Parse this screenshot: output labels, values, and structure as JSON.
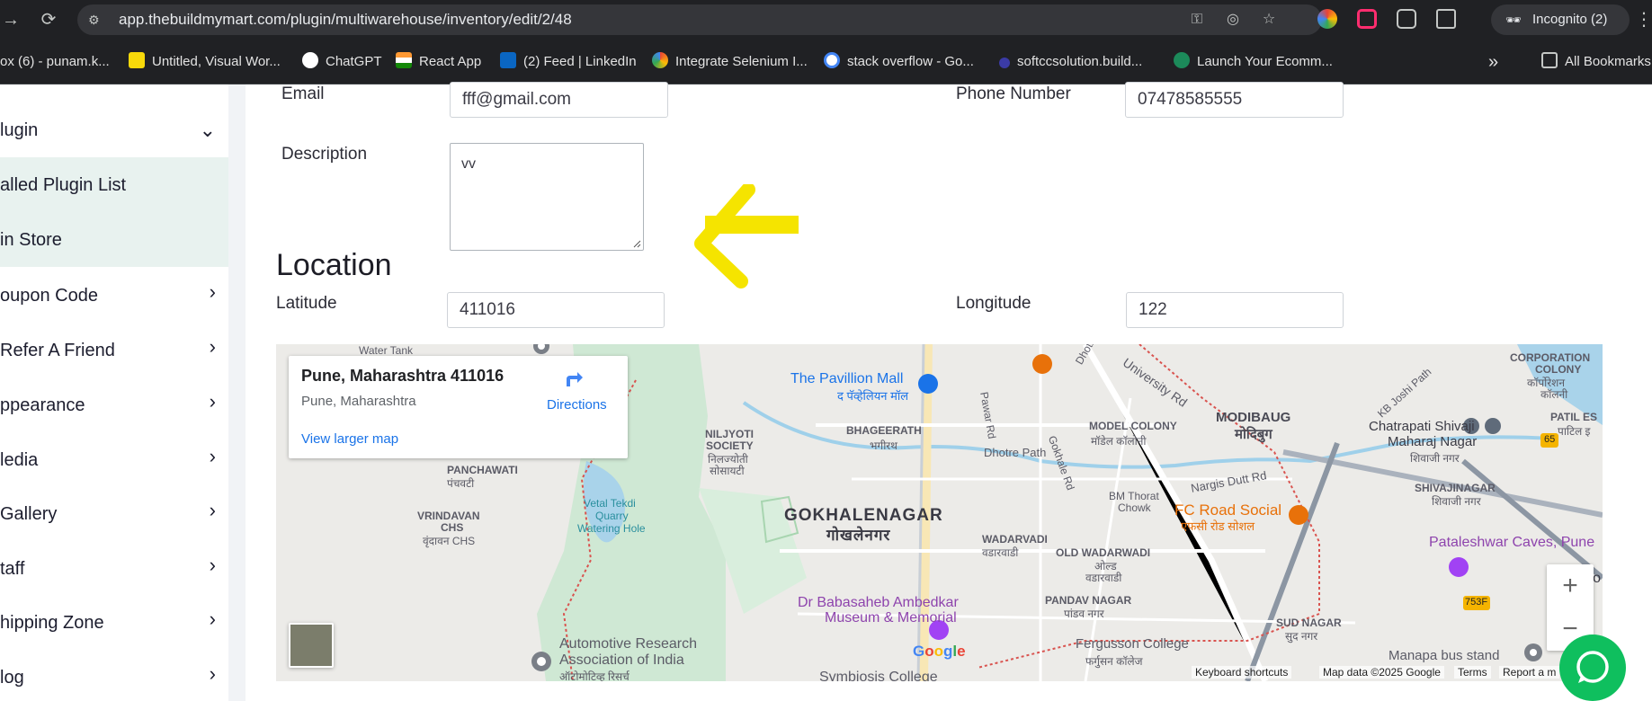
{
  "browser": {
    "url": "app.thebuildmymart.com/plugin/multiwarehouse/inventory/edit/2/48",
    "incognito_label": "Incognito (2)",
    "all_bookmarks": "All Bookmarks",
    "bookmarks": [
      "ox (6) - punam.k...",
      "Untitled, Visual Wor...",
      "ChatGPT",
      "React App",
      "(2) Feed | LinkedIn",
      "Integrate Selenium I...",
      "stack overflow - Go...",
      "softccsolution.build...",
      "Launch Your Ecomm..."
    ],
    "overflow": "»"
  },
  "sidebar": {
    "items": [
      {
        "label": "lugin",
        "chevron": "⌄"
      },
      {
        "label": "alled Plugin List"
      },
      {
        "label": "in Store"
      },
      {
        "label": "oupon Code",
        "chevron": "›"
      },
      {
        "label": "Refer A Friend",
        "chevron": "›"
      },
      {
        "label": "ppearance",
        "chevron": "›"
      },
      {
        "label": "ledia",
        "chevron": "›"
      },
      {
        "label": "Gallery",
        "chevron": "›"
      },
      {
        "label": "taff",
        "chevron": "›"
      },
      {
        "label": "hipping Zone",
        "chevron": "›"
      },
      {
        "label": "log",
        "chevron": "›"
      }
    ]
  },
  "form": {
    "email_label": "Email",
    "email_value": "fff@gmail.com",
    "phone_label": "Phone Number",
    "phone_value": "07478585555",
    "description_label": "Description",
    "description_value": "vv",
    "location_title": "Location",
    "latitude_label": "Latitude",
    "latitude_value": "411016",
    "longitude_label": "Longitude",
    "longitude_value": "122"
  },
  "map": {
    "info_title": "Pune, Maharashtra 411016",
    "info_subtitle": "Pune, Maharashtra",
    "directions": "Directions",
    "view_larger": "View larger map",
    "labels": {
      "water_tank": "Water Tank",
      "pavillion_mall": "The Pavillion Mall",
      "pavillion_mall_hi": "द पॅव्हेलियन मॉल",
      "niljyoti_1": "NILJYOTI",
      "niljyoti_2": "SOCIETY",
      "niljyoti_3": "निलज्योती",
      "niljyoti_4": "सोसायटी",
      "bhageerath": "BHAGEERATH",
      "bhageerath_hi": "भगीरथ",
      "model_colony": "MODEL COLONY",
      "model_colony_hi": "मॉडेल कॉलोनी",
      "modibaug": "MODIBAUG",
      "modibaug_hi": "मोदिबुग",
      "chatrapati_1": "Chatrapati Shivaji",
      "chatrapati_2": "Maharaj Nagar",
      "chatrapati_hi": "शिवाजी नगर",
      "corporation_1": "CORPORATION",
      "corporation_2": "COLONY",
      "corporation_3": "कॉर्पोरेशन",
      "corporation_4": "कॉलनी",
      "patil": "PATIL ES",
      "patil_hi": "पाटिल इ",
      "panchawati": "PANCHAWATI",
      "panchawati_hi": "पंचवटी",
      "vrindavan_1": "VRINDAVAN",
      "vrindavan_2": "CHS",
      "vrindavan_hi": "वृंदावन CHS",
      "vetal_1": "Vetal Tekdi",
      "vetal_2": "Quarry",
      "vetal_3": "Watering Hole",
      "gokhalenagar": "GOKHALENAGAR",
      "gokhalenagar_hi": "गोखलेनगर",
      "bm_thorat_1": "BM Thorat",
      "bm_thorat_2": "Chowk",
      "fc_road": "FC Road Social",
      "fc_road_hi": "एफसी रोड सोशल",
      "shivajinagar": "SHIVAJINAGAR",
      "shivajinagar_hi": "शिवाजी नगर",
      "pataleshwar": "Pataleshwar Caves, Pune",
      "wadarvadi": "WADARVADI",
      "wadarvadi_hi": "वडारवाडी",
      "old_wadarwadi": "OLD WADARWADI",
      "old_wadarwadi_hi1": "ओल्ड",
      "old_wadarwadi_hi2": "वडारवाडी",
      "ambedkar_1": "Dr Babasaheb Ambedkar",
      "ambedkar_2": "Museum & Memorial",
      "pandav_nagar": "PANDAV NAGAR",
      "pandav_nagar_hi": "पांडव नगर",
      "sud_nagar": "SUD NAGAR",
      "sud_nagar_hi": "सुद नगर",
      "fergusson": "Fergusson College",
      "fergusson_hi": "फर्गुसन कॉलेज",
      "manapa": "Manapa bus stand",
      "automotive_1": "Automotive Research",
      "automotive_2": "Association of India",
      "automotive_hi": "ऑटोमोटिव्ह रिसर्च",
      "symbiosis": "Symbiosis College",
      "dhotre_path": "Dhotre Path",
      "dhotre_path2": "Dhotre Path",
      "university_rd": "University Rd",
      "pawar_rd": "Pawar Rd",
      "gokhale_rd": "Gokhale Rd",
      "nargis_dutt": "Nargis Dutt Rd",
      "kb_joshi": "KB Joshi Path",
      "nh_65": "65",
      "nh_753f": "753F",
      "di_co": "Di Co"
    },
    "google": "Google",
    "keyboard_shortcuts": "Keyboard shortcuts",
    "map_data": "Map data ©2025 Google",
    "terms": "Terms",
    "report": "Report a m",
    "zoom_in": "+",
    "zoom_out": "−"
  },
  "colors": {
    "arrow": "#f5e400",
    "chat": "#0fbf5e",
    "sidebar_active": "#e8f2ef",
    "link": "#1a73e8"
  }
}
